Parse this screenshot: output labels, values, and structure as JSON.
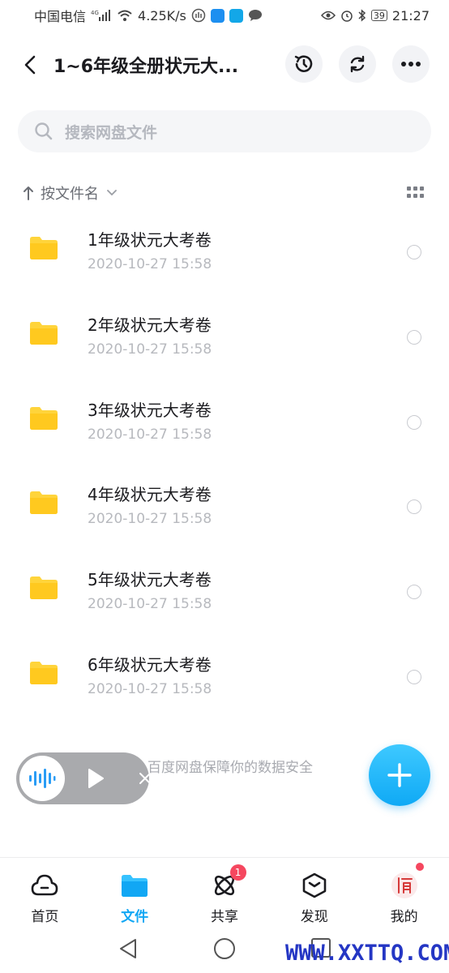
{
  "status_bar": {
    "carrier": "中国电信",
    "network": "4G",
    "speed": "4.25K/s",
    "battery": "39",
    "time": "21:27"
  },
  "header": {
    "title": "1~6年级全册状元大...",
    "icons": [
      "back-arrow",
      "history-clock",
      "refresh",
      "more-dots"
    ]
  },
  "search": {
    "placeholder": "搜索网盘文件"
  },
  "sort": {
    "label": "按文件名"
  },
  "files": [
    {
      "name": "1年级状元大考卷",
      "date": "2020-10-27  15:58"
    },
    {
      "name": "2年级状元大考卷",
      "date": "2020-10-27  15:58"
    },
    {
      "name": "3年级状元大考卷",
      "date": "2020-10-27  15:58"
    },
    {
      "name": "4年级状元大考卷",
      "date": "2020-10-27  15:58"
    },
    {
      "name": "5年级状元大考卷",
      "date": "2020-10-27  15:58"
    },
    {
      "name": "6年级状元大考卷",
      "date": "2020-10-27  15:58"
    }
  ],
  "footer_note": "百度网盘保障你的数据安全",
  "bottom_nav": {
    "items": [
      {
        "label": "首页"
      },
      {
        "label": "文件"
      },
      {
        "label": "共享",
        "badge": "1"
      },
      {
        "label": "发现"
      },
      {
        "label": "我的"
      }
    ]
  },
  "watermark": "WWW.XXTTQ.COM",
  "colors": {
    "accent": "#11a7f4",
    "folder": "#ffd43b",
    "badge": "#f5475f"
  }
}
